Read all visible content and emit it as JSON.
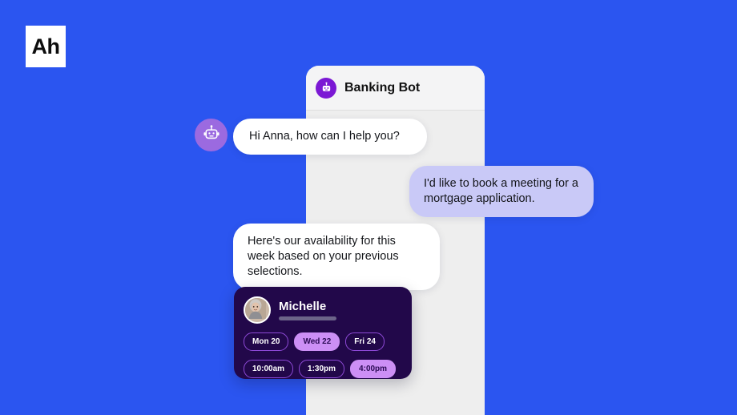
{
  "brand": {
    "logo_text": "Ah"
  },
  "panel": {
    "header": {
      "title": "Banking Bot",
      "bot_icon": "robot-icon"
    }
  },
  "conversation": {
    "bot_avatar_icon": "robot-icon",
    "messages": [
      {
        "sender": "bot",
        "text": "Hi Anna, how can I help you?"
      },
      {
        "sender": "user",
        "text": "I'd like to book a meeting for a mortgage application."
      },
      {
        "sender": "bot",
        "text": "Here's our availability for this week based on your previous selections."
      }
    ]
  },
  "booking_card": {
    "person_name": "Michelle",
    "avatar_icon": "user-photo-avatar",
    "dates": [
      {
        "label": "Mon 20",
        "selected": false
      },
      {
        "label": "Wed 22",
        "selected": true
      },
      {
        "label": "Fri 24",
        "selected": false
      }
    ],
    "times": [
      {
        "label": "10:00am",
        "selected": false
      },
      {
        "label": "1:30pm",
        "selected": false
      },
      {
        "label": "4:00pm",
        "selected": true
      }
    ]
  },
  "colors": {
    "background_blue": "#2b55f0",
    "panel_grey": "#eeeeee",
    "accent_purple": "#7b18d4",
    "avatar_purple": "#9b6ae0",
    "user_bubble": "#c9c9f7",
    "card_dark": "#22084a",
    "chip_selected": "#cc8ff5"
  }
}
